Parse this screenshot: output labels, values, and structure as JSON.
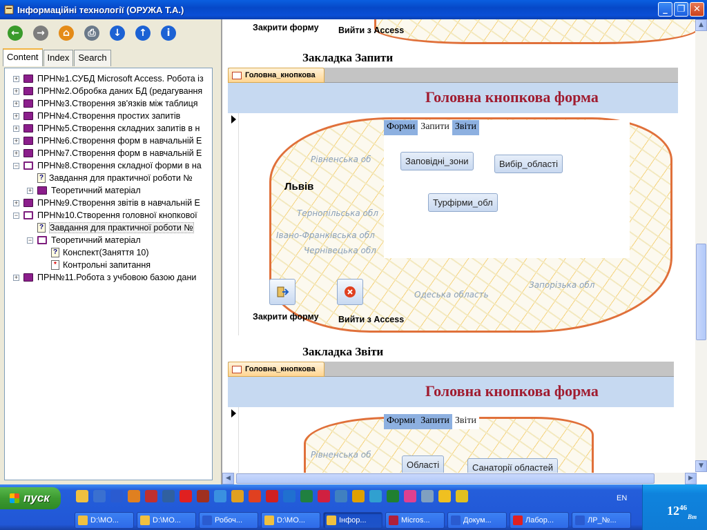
{
  "window": {
    "title": "Інформаційні технології (ОРУЖА Т.А.)",
    "minimize_label": "_",
    "restore_label": "❐",
    "close_label": "✕"
  },
  "toolbar": {
    "buttons": [
      {
        "name": "back-button",
        "glyph": "←",
        "color": "#3a9b2b"
      },
      {
        "name": "forward-button",
        "glyph": "→",
        "color": "#7d7d7d"
      },
      {
        "name": "home-button",
        "glyph": "⌂",
        "color": "#e48b18"
      },
      {
        "name": "print-button",
        "glyph": "⎙",
        "color": "#6b7a8a"
      },
      {
        "name": "down-button",
        "glyph": "↓",
        "color": "#1c62d4"
      },
      {
        "name": "up-button",
        "glyph": "↑",
        "color": "#1c62d4"
      },
      {
        "name": "info-button",
        "glyph": "i",
        "color": "#1c62d4"
      }
    ]
  },
  "nav_tabs": [
    "Content",
    "Index",
    "Search"
  ],
  "tree": [
    {
      "label": "ПРН№1.СУБД Microsoft Access. Робота із",
      "exp": "+",
      "icon": "book",
      "indent": 0
    },
    {
      "label": "ПРН№2.Обробка даних БД (редагування",
      "exp": "+",
      "icon": "book",
      "indent": 0
    },
    {
      "label": "ПРН№3.Створення зв'язків між таблиця",
      "exp": "+",
      "icon": "book",
      "indent": 0
    },
    {
      "label": "ПРН№4.Створення простих запитів",
      "exp": "+",
      "icon": "book",
      "indent": 0
    },
    {
      "label": "ПРН№5.Створення складних запитів в н",
      "exp": "+",
      "icon": "book",
      "indent": 0
    },
    {
      "label": "ПРН№6.Створення форм в навчальній Е",
      "exp": "+",
      "icon": "book",
      "indent": 0
    },
    {
      "label": "ПРН№7.Створення форм в навчальній Е",
      "exp": "+",
      "icon": "book",
      "indent": 0
    },
    {
      "label": "ПРН№8.Створення складної форми в на",
      "exp": "−",
      "icon": "book-open",
      "indent": 0
    },
    {
      "label": "Завдання для практичної роботи №",
      "exp": "",
      "icon": "page",
      "indent": 1
    },
    {
      "label": "Теоретичний матеріал",
      "exp": "+",
      "icon": "book",
      "indent": 1
    },
    {
      "label": "ПРН№9.Створення звітів в навчальній Е",
      "exp": "+",
      "icon": "book",
      "indent": 0
    },
    {
      "label": "ПРН№10.Створення головної кнопкової",
      "exp": "−",
      "icon": "book-open",
      "indent": 0
    },
    {
      "label": "Завдання для практичної роботи №",
      "exp": "",
      "icon": "page",
      "indent": 1,
      "selected": true
    },
    {
      "label": "Теоретичний матеріал",
      "exp": "−",
      "icon": "book-open",
      "indent": 1
    },
    {
      "label": "Конспект(Заняття 10)",
      "exp": "",
      "icon": "page",
      "indent": 2
    },
    {
      "label": "Контрольні запитання",
      "exp": "",
      "icon": "page-red",
      "indent": 2
    },
    {
      "label": "ПРН№11.Робота з учбовою базою дани",
      "exp": "+",
      "icon": "book",
      "indent": 0
    }
  ],
  "content": {
    "top_close_caption": "Закрити форму",
    "top_exit_caption": "Вийти з Access",
    "heading_queries": "Закладка Запити",
    "heading_reports": "Закладка Звіти",
    "form1": {
      "tab_label": "Головна_кнопкова",
      "header_title": "Головна кнопкова форма",
      "city": "Львів",
      "tabs": [
        {
          "label": "Форми",
          "active": false
        },
        {
          "label": "Запити",
          "active": true
        },
        {
          "label": "Звіти",
          "active": false
        }
      ],
      "buttons": [
        "Заповідні_зони",
        "Вибір_області",
        "Турфірми_обл"
      ],
      "map_labels": [
        "Рівненська об",
        "Тернопільська обл",
        "Івано-Франківська обл",
        "Чернівецька обл",
        "Одеська область",
        "Запорізька обл"
      ],
      "close_caption": "Закрити форму",
      "exit_caption": "Вийти з Access"
    },
    "form2": {
      "tab_label": "Головна_кнопкова",
      "header_title": "Головна кнопкова форма",
      "tabs": [
        {
          "label": "Форми",
          "active": false
        },
        {
          "label": "Запити",
          "active": false
        },
        {
          "label": "Звіти",
          "active": true
        }
      ],
      "buttons": [
        "Області",
        "Санаторії областей"
      ],
      "map_labels": [
        "Рівненська об"
      ]
    }
  },
  "taskbar": {
    "start_label": "пуск",
    "lang": "EN",
    "clock_hour": "12",
    "clock_min": "46",
    "clock_day": "Вт",
    "tasks": [
      {
        "label": "D:\\MO...",
        "color": "#f0c040"
      },
      {
        "label": "D:\\MO...",
        "color": "#f0c040"
      },
      {
        "label": "Робоч...",
        "color": "#2a5bd0"
      },
      {
        "label": "D:\\MO...",
        "color": "#f0c040"
      },
      {
        "label": "Інфор...",
        "color": "#f0c040",
        "active": true
      },
      {
        "label": "Micros...",
        "color": "#b0203a"
      },
      {
        "label": "Докум...",
        "color": "#2a5bd0"
      },
      {
        "label": "Лабор...",
        "color": "#e02020"
      },
      {
        "label": "ЛР_№...",
        "color": "#2a5bd0"
      }
    ]
  }
}
